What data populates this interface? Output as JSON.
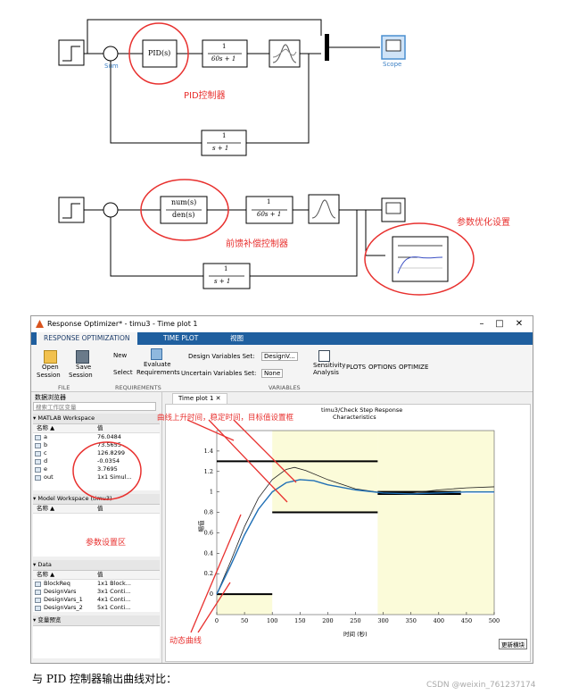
{
  "diagram1": {
    "sum_label": "Sum",
    "pid_label": "PID(s)",
    "plant_num": "1",
    "plant_den": "60s + 1",
    "feedback_num": "1",
    "feedback_den": "s + 1",
    "scope_label": "Scope",
    "note": "PID控制器"
  },
  "diagram2": {
    "ff_num": "num(s)",
    "ff_den": "den(s)",
    "plant_num": "1",
    "plant_den": "60s + 1",
    "feedback_num": "1",
    "feedback_den": "s + 1",
    "note_ff": "前馈补偿控制器",
    "note_opt": "参数优化设置"
  },
  "window": {
    "title": "Response Optimizer* - timu3 - Time plot 1",
    "tabs": [
      "RESPONSE OPTIMIZATION",
      "TIME PLOT",
      "视图"
    ],
    "toolstrip": {
      "open": "Open",
      "open2": "Session",
      "save": "Save",
      "save2": "Session",
      "new": "New",
      "select": "Select",
      "evaluate": "Evaluate",
      "evaluate2": "Requirements",
      "design_vars_label": "Design Variables Set:",
      "design_vars_value": "DesignV...",
      "uncertain_label": "Uncertain Variables Set:",
      "uncertain_value": "None",
      "sensitivity": "Sensitivity",
      "sensitivity2": "Analysis",
      "plots": "PLOTS",
      "options": "OPTIONS",
      "optimize": "OPTIMIZE",
      "group_file": "FILE",
      "group_req": "REQUIREMENTS",
      "group_vars": "VARIABLES"
    },
    "browser": {
      "title": "数据浏览器",
      "search_placeholder": "搜索工作区变量",
      "matlab_ws": "MATLAB Workspace",
      "col_name": "名称 ▲",
      "col_value": "值",
      "vars": [
        {
          "name": "a",
          "value": "76.0484"
        },
        {
          "name": "b",
          "value": "73.5655"
        },
        {
          "name": "c",
          "value": "126.8299"
        },
        {
          "name": "d",
          "value": "-0.0354"
        },
        {
          "name": "e",
          "value": "3.7695"
        },
        {
          "name": "out",
          "value": "1x1 Simul..."
        }
      ],
      "model_ws": "Model Workspace (timu3)",
      "data": "Data",
      "data_items": [
        {
          "name": "BlockReq",
          "value": "1x1 Block..."
        },
        {
          "name": "DesignVars",
          "value": "3x1 Conti..."
        },
        {
          "name": "DesignVars_1",
          "value": "4x1 Conti..."
        },
        {
          "name": "DesignVars_2",
          "value": "5x1 Conti..."
        }
      ],
      "var_preview": "变量预览",
      "note_params": "参数设置区"
    },
    "plot_tab": "Time plot 1",
    "plot": {
      "title": "timu3/Check Step Response",
      "title2": "Characteristics",
      "xlabel": "时间 (秒)",
      "ylabel": "幅值",
      "update_btn": "更新横块",
      "note_bounds": "曲线上升时间，稳定时间，目标值设置框",
      "note_curve": "动态曲线"
    }
  },
  "caption": "与 PID 控制器输出曲线对比：",
  "watermark": "CSDN @weixin_761237174",
  "chart_data": {
    "type": "line",
    "title": "timu3/Check Step Response Characteristics",
    "xlabel": "时间 (秒)",
    "ylabel": "幅值",
    "xlim": [
      0,
      500
    ],
    "ylim": [
      -0.2,
      1.6
    ],
    "xticks": [
      0,
      50,
      100,
      150,
      200,
      250,
      300,
      350,
      400,
      450,
      500
    ],
    "yticks": [
      0,
      0.2,
      0.4,
      0.6,
      0.8,
      1,
      1.2,
      1.4
    ],
    "series": [
      {
        "values": [
          [
            0,
            0
          ],
          [
            25,
            0.32
          ],
          [
            50,
            0.66
          ],
          [
            75,
            0.94
          ],
          [
            100,
            1.12
          ],
          [
            125,
            1.22
          ],
          [
            140,
            1.24
          ],
          [
            160,
            1.21
          ],
          [
            200,
            1.12
          ],
          [
            250,
            1.03
          ],
          [
            300,
            0.99
          ],
          [
            350,
            0.99
          ],
          [
            400,
            1.02
          ],
          [
            450,
            1.04
          ],
          [
            500,
            1.05
          ]
        ],
        "color": "#1f1f1f"
      },
      {
        "values": [
          [
            0,
            0
          ],
          [
            25,
            0.28
          ],
          [
            50,
            0.58
          ],
          [
            75,
            0.83
          ],
          [
            100,
            1.0
          ],
          [
            125,
            1.09
          ],
          [
            150,
            1.12
          ],
          [
            175,
            1.11
          ],
          [
            200,
            1.07
          ],
          [
            250,
            1.02
          ],
          [
            300,
            0.99
          ],
          [
            350,
            0.98
          ],
          [
            400,
            0.99
          ],
          [
            450,
            1.0
          ],
          [
            500,
            1.0
          ]
        ],
        "color": "#1f6fb5"
      }
    ],
    "bounds": [
      {
        "x": [
          0,
          290
        ],
        "y": 1.3
      },
      {
        "x": [
          100,
          290
        ],
        "y": 0.8
      },
      {
        "x": [
          0,
          100
        ],
        "y": 0
      },
      {
        "x": [
          290,
          440
        ],
        "y": 0.98
      },
      {
        "x": [
          290,
          440
        ],
        "y": 1.0
      }
    ]
  }
}
